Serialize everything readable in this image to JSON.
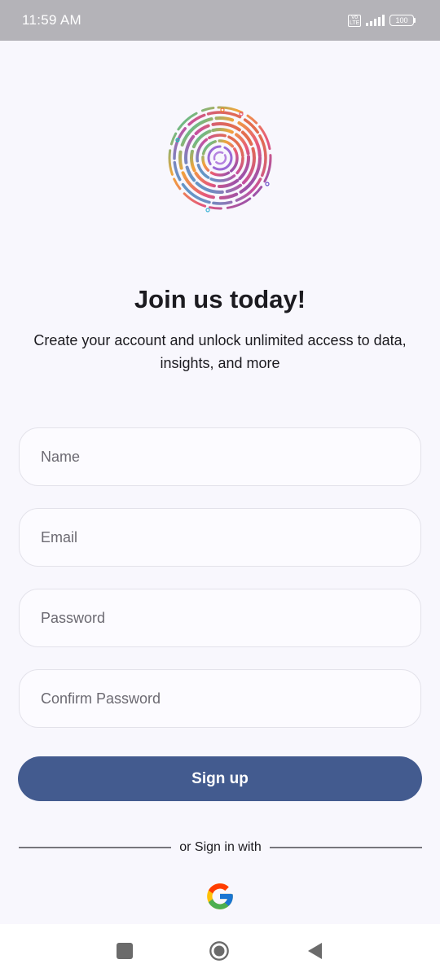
{
  "status_bar": {
    "time": "11:59 AM",
    "volte_label": "Vo LTE",
    "battery": "100"
  },
  "header": {
    "title": "Join us today!",
    "subtitle": "Create your account and unlock unlimited access to data, insights, and more"
  },
  "form": {
    "name_placeholder": "Name",
    "email_placeholder": "Email",
    "password_placeholder": "Password",
    "confirm_password_placeholder": "Confirm Password",
    "signup_label": "Sign up"
  },
  "social": {
    "divider_text": "or Sign in with",
    "google_icon": "google-icon"
  },
  "colors": {
    "primary": "#435b8f",
    "background": "#f8f7fd",
    "status_bar": "#b4b3b8"
  }
}
